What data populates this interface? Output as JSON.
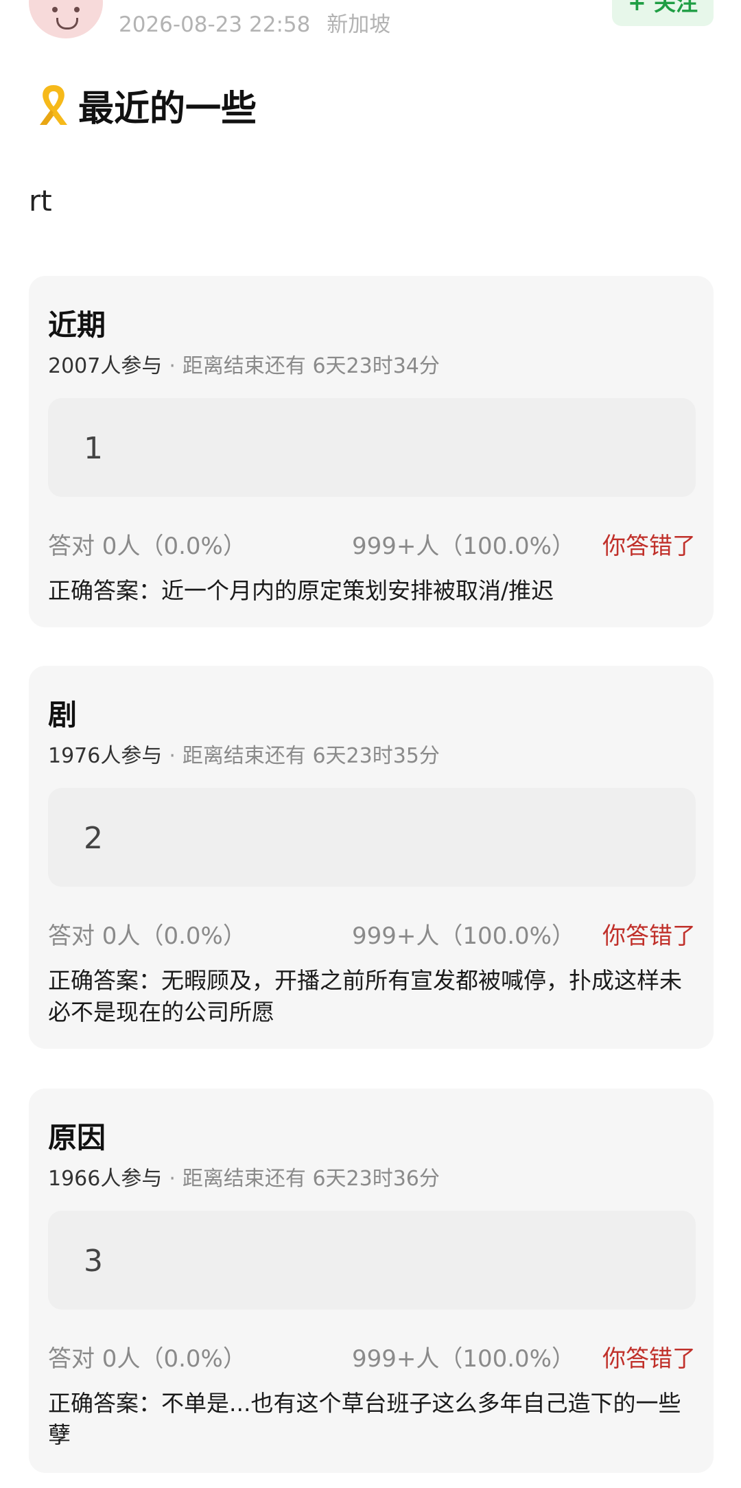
{
  "post": {
    "timestamp": "2026-08-23 22:58",
    "location": "新加坡",
    "follow_label": "+ 关注",
    "title": "最近的一些",
    "title_icon": "yellow-ribbon-icon",
    "body": "rt"
  },
  "colors": {
    "card_bg": "#f6f6f6",
    "answer_box_bg": "#efefef",
    "wrong_result": "#c0302a",
    "follow_text": "#1f9e44",
    "follow_bg": "#e7f7ea"
  },
  "quizzes": [
    {
      "title": "近期",
      "participants": "2007人参与",
      "timer": "距离结束还有 6天23时34分",
      "option": "1",
      "correct_stat": "答对  0人（0.0%）",
      "wrong_stat": "999+人（100.0%）",
      "result": "你答错了",
      "answer": "正确答案：近一个月内的原定策划安排被取消/推迟"
    },
    {
      "title": "剧",
      "participants": "1976人参与",
      "timer": "距离结束还有 6天23时35分",
      "option": "2",
      "correct_stat": "答对  0人（0.0%）",
      "wrong_stat": "999+人（100.0%）",
      "result": "你答错了",
      "answer": "正确答案：无暇顾及，开播之前所有宣发都被喊停，扑成这样未必不是现在的公司所愿"
    },
    {
      "title": "原因",
      "participants": "1966人参与",
      "timer": "距离结束还有 6天23时36分",
      "option": "3",
      "correct_stat": "答对  0人（0.0%）",
      "wrong_stat": "999+人（100.0%）",
      "result": "你答错了",
      "answer": "正确答案：不单是...也有这个草台班子这么多年自己造下的一些孽"
    }
  ]
}
